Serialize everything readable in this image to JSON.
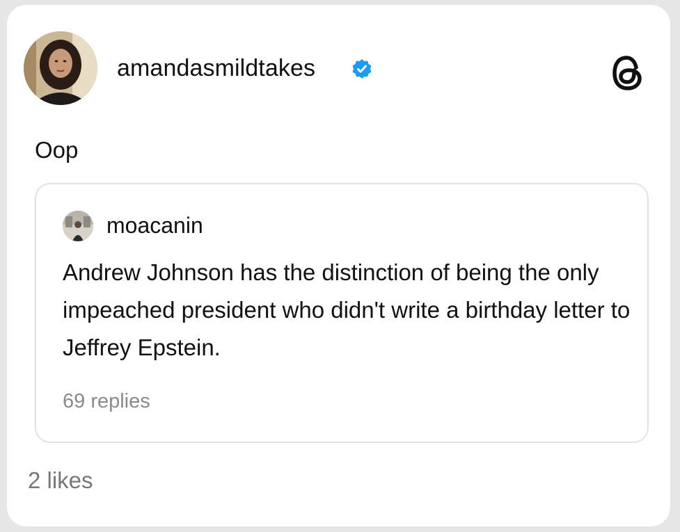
{
  "post": {
    "username": "amandasmildtakes",
    "verified_icon": "verified-badge-icon",
    "app_icon": "threads-logo-icon",
    "text": "Oop",
    "likes": "2 likes"
  },
  "quoted_post": {
    "username": "moacanin",
    "text": "Andrew Johnson has the distinction of being the only impeached president who didn't write a birthday letter to Jeffrey Epstein.",
    "replies": "69 replies"
  },
  "colors": {
    "verified_blue": "#1d9bf0",
    "text_primary": "#111111",
    "text_secondary": "#8a8a8a",
    "border": "#e2e2e2"
  }
}
